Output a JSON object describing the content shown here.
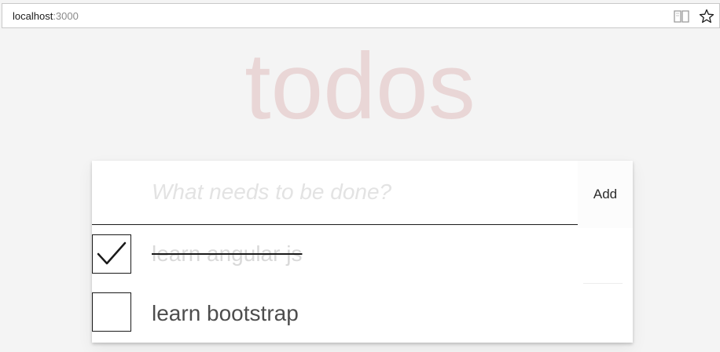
{
  "browser": {
    "url_host": "localhost",
    "url_port": ":3000",
    "icons": {
      "reading_view": "book-open-icon",
      "favorite": "star-icon"
    }
  },
  "app": {
    "title": "todos",
    "title_color": "#af2f2f",
    "new_todo": {
      "placeholder": "What needs to be done?",
      "value": "",
      "add_label": "Add"
    },
    "todos": [
      {
        "label": "learn angular js",
        "completed": true
      },
      {
        "label": "learn bootstrap",
        "completed": false
      }
    ]
  }
}
